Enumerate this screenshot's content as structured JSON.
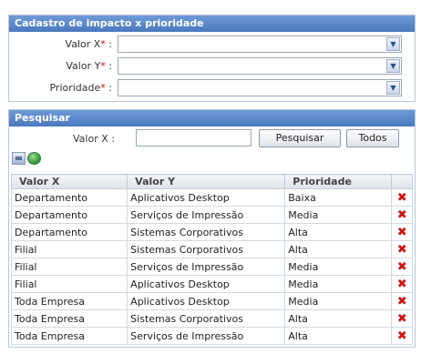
{
  "form": {
    "title": "Cadastro de impacto x prioridade",
    "fields": [
      {
        "label": "Valor X",
        "required_mark": "*",
        "suffix": " :",
        "value": ""
      },
      {
        "label": "Valor Y",
        "required_mark": "*",
        "suffix": " :",
        "value": ""
      },
      {
        "label": "Prioridade",
        "required_mark": "*",
        "suffix": " :",
        "value": ""
      }
    ]
  },
  "search": {
    "title": "Pesquisar",
    "label": "Valor X :",
    "value": "",
    "search_button": "Pesquisar",
    "all_button": "Todos"
  },
  "table": {
    "headers": [
      "Valor X",
      "Valor Y",
      "Prioridade"
    ],
    "rows": [
      [
        "Departamento",
        "Aplicativos Desktop",
        "Baixa"
      ],
      [
        "Departamento",
        "Serviços de Impressão",
        "Media"
      ],
      [
        "Departamento",
        "Sistemas Corporativos",
        "Alta"
      ],
      [
        "Filial",
        "Sistemas Corporativos",
        "Alta"
      ],
      [
        "Filial",
        "Serviços de Impressão",
        "Media"
      ],
      [
        "Filial",
        "Aplicativos Desktop",
        "Media"
      ],
      [
        "Toda Empresa",
        "Aplicativos Desktop",
        "Media"
      ],
      [
        "Toda Empresa",
        "Sistemas Corporativos",
        "Alta"
      ],
      [
        "Toda Empresa",
        "Serviços de Impressão",
        "Alta"
      ]
    ]
  },
  "icons": {
    "delete": "delete-x-icon",
    "print": "print-icon",
    "globe": "globe-icon",
    "dropdown": "chevron-down-icon"
  },
  "colors": {
    "panel_header": "#4a78bd",
    "required": "#d40000",
    "delete": "#d01414"
  }
}
